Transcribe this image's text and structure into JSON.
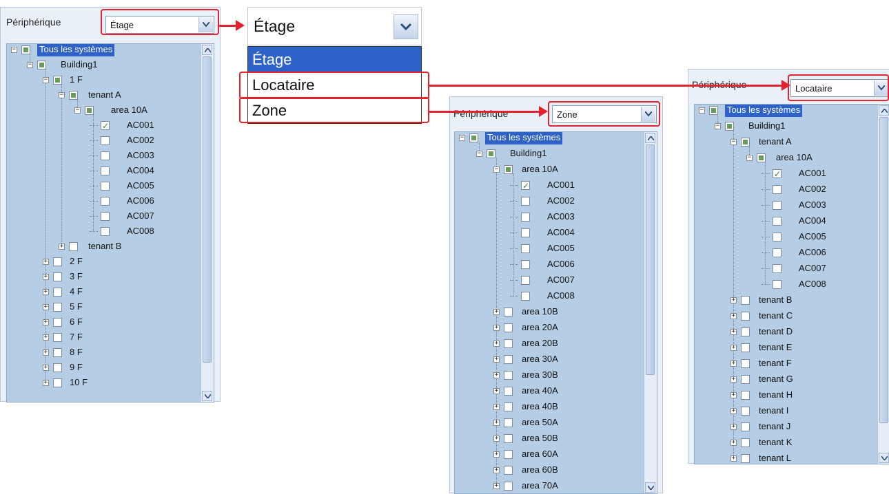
{
  "panels": [
    {
      "label": "Périphérique",
      "combo_value": "Étage",
      "root_label": "Tous les systèmes",
      "nodes": [
        {
          "label": "Building1",
          "level": 1,
          "expander": "minus",
          "check": "partial"
        },
        {
          "label": "1 F",
          "level": 2,
          "expander": "minus",
          "check": "partial"
        },
        {
          "label": "tenant A",
          "level": 3,
          "expander": "minus",
          "check": "partial"
        },
        {
          "label": "area 10A",
          "level": 4,
          "expander": "minus",
          "check": "partial"
        },
        {
          "label": "AC001",
          "level": 5,
          "expander": "none",
          "check": "checked"
        },
        {
          "label": "AC002",
          "level": 5,
          "expander": "none",
          "check": "none"
        },
        {
          "label": "AC003",
          "level": 5,
          "expander": "none",
          "check": "none"
        },
        {
          "label": "AC004",
          "level": 5,
          "expander": "none",
          "check": "none"
        },
        {
          "label": "AC005",
          "level": 5,
          "expander": "none",
          "check": "none"
        },
        {
          "label": "AC006",
          "level": 5,
          "expander": "none",
          "check": "none"
        },
        {
          "label": "AC007",
          "level": 5,
          "expander": "none",
          "check": "none"
        },
        {
          "label": "AC008",
          "level": 5,
          "expander": "none",
          "check": "none"
        },
        {
          "label": "tenant B",
          "level": 3,
          "expander": "plus",
          "check": "none"
        },
        {
          "label": "2 F",
          "level": 2,
          "expander": "plus",
          "check": "none"
        },
        {
          "label": "3 F",
          "level": 2,
          "expander": "plus",
          "check": "none"
        },
        {
          "label": "4 F",
          "level": 2,
          "expander": "plus",
          "check": "none"
        },
        {
          "label": "5 F",
          "level": 2,
          "expander": "plus",
          "check": "none"
        },
        {
          "label": "6 F",
          "level": 2,
          "expander": "plus",
          "check": "none"
        },
        {
          "label": "7 F",
          "level": 2,
          "expander": "plus",
          "check": "none"
        },
        {
          "label": "8 F",
          "level": 2,
          "expander": "plus",
          "check": "none"
        },
        {
          "label": "9 F",
          "level": 2,
          "expander": "plus",
          "check": "none"
        },
        {
          "label": "10 F",
          "level": 2,
          "expander": "plus",
          "check": "none"
        }
      ]
    },
    {
      "label": "Périphérique",
      "combo_value": "Zone",
      "root_label": "Tous les systèmes",
      "nodes": [
        {
          "label": "Building1",
          "level": 1,
          "expander": "minus",
          "check": "partial"
        },
        {
          "label": "area 10A",
          "level": 2,
          "expander": "minus",
          "check": "partial"
        },
        {
          "label": "AC001",
          "level": 3,
          "expander": "none",
          "check": "checked"
        },
        {
          "label": "AC002",
          "level": 3,
          "expander": "none",
          "check": "none"
        },
        {
          "label": "AC003",
          "level": 3,
          "expander": "none",
          "check": "none"
        },
        {
          "label": "AC004",
          "level": 3,
          "expander": "none",
          "check": "none"
        },
        {
          "label": "AC005",
          "level": 3,
          "expander": "none",
          "check": "none"
        },
        {
          "label": "AC006",
          "level": 3,
          "expander": "none",
          "check": "none"
        },
        {
          "label": "AC007",
          "level": 3,
          "expander": "none",
          "check": "none"
        },
        {
          "label": "AC008",
          "level": 3,
          "expander": "none",
          "check": "none"
        },
        {
          "label": "area 10B",
          "level": 2,
          "expander": "plus",
          "check": "none"
        },
        {
          "label": "area 20A",
          "level": 2,
          "expander": "plus",
          "check": "none"
        },
        {
          "label": "area 20B",
          "level": 2,
          "expander": "plus",
          "check": "none"
        },
        {
          "label": "area 30A",
          "level": 2,
          "expander": "plus",
          "check": "none"
        },
        {
          "label": "area 30B",
          "level": 2,
          "expander": "plus",
          "check": "none"
        },
        {
          "label": "area 40A",
          "level": 2,
          "expander": "plus",
          "check": "none"
        },
        {
          "label": "area 40B",
          "level": 2,
          "expander": "plus",
          "check": "none"
        },
        {
          "label": "area 50A",
          "level": 2,
          "expander": "plus",
          "check": "none"
        },
        {
          "label": "area 50B",
          "level": 2,
          "expander": "plus",
          "check": "none"
        },
        {
          "label": "area 60A",
          "level": 2,
          "expander": "plus",
          "check": "none"
        },
        {
          "label": "area 60B",
          "level": 2,
          "expander": "plus",
          "check": "none"
        },
        {
          "label": "area 70A",
          "level": 2,
          "expander": "plus",
          "check": "none"
        }
      ]
    },
    {
      "label": "Périphérique",
      "combo_value": "Locataire",
      "root_label": "Tous les systèmes",
      "nodes": [
        {
          "label": "Building1",
          "level": 1,
          "expander": "minus",
          "check": "partial"
        },
        {
          "label": "tenant A",
          "level": 2,
          "expander": "minus",
          "check": "partial"
        },
        {
          "label": "area 10A",
          "level": 3,
          "expander": "minus",
          "check": "partial"
        },
        {
          "label": "AC001",
          "level": 4,
          "expander": "none",
          "check": "checked"
        },
        {
          "label": "AC002",
          "level": 4,
          "expander": "none",
          "check": "none"
        },
        {
          "label": "AC003",
          "level": 4,
          "expander": "none",
          "check": "none"
        },
        {
          "label": "AC004",
          "level": 4,
          "expander": "none",
          "check": "none"
        },
        {
          "label": "AC005",
          "level": 4,
          "expander": "none",
          "check": "none"
        },
        {
          "label": "AC006",
          "level": 4,
          "expander": "none",
          "check": "none"
        },
        {
          "label": "AC007",
          "level": 4,
          "expander": "none",
          "check": "none"
        },
        {
          "label": "AC008",
          "level": 4,
          "expander": "none",
          "check": "none"
        },
        {
          "label": "tenant B",
          "level": 2,
          "expander": "plus",
          "check": "none"
        },
        {
          "label": "tenant C",
          "level": 2,
          "expander": "plus",
          "check": "none"
        },
        {
          "label": "tenant D",
          "level": 2,
          "expander": "plus",
          "check": "none"
        },
        {
          "label": "tenant E",
          "level": 2,
          "expander": "plus",
          "check": "none"
        },
        {
          "label": "tenant F",
          "level": 2,
          "expander": "plus",
          "check": "none"
        },
        {
          "label": "tenant G",
          "level": 2,
          "expander": "plus",
          "check": "none"
        },
        {
          "label": "tenant H",
          "level": 2,
          "expander": "plus",
          "check": "none"
        },
        {
          "label": "tenant I",
          "level": 2,
          "expander": "plus",
          "check": "none"
        },
        {
          "label": "tenant J",
          "level": 2,
          "expander": "plus",
          "check": "none"
        },
        {
          "label": "tenant K",
          "level": 2,
          "expander": "plus",
          "check": "none"
        },
        {
          "label": "tenant L",
          "level": 2,
          "expander": "plus",
          "check": "none"
        }
      ]
    }
  ],
  "dropdown": {
    "value": "Étage",
    "options": [
      "Étage",
      "Locataire",
      "Zone"
    ],
    "selected_option": "Étage"
  },
  "colors": {
    "annotation": "#e3222d",
    "selection": "#2f62c8",
    "tree_background": "#b6cde6"
  }
}
